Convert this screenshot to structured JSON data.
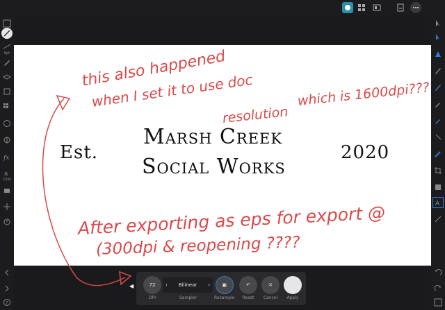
{
  "toolbar": {
    "buttons": [
      "persona-icon",
      "grid-icon",
      "export-icon",
      "document-icon",
      "more-icon"
    ]
  },
  "left_tools": {
    "brush_size_label": "8pt",
    "opacity_label": "12pt"
  },
  "document": {
    "logo": {
      "est": "Est.",
      "line1": "Marsh Creek",
      "line2": "Social Works",
      "year": "2020"
    },
    "annotations": [
      "this also happened",
      "when I set it to use doc",
      "resolution",
      "which is 1600dpi???",
      "After exporting as eps for export @",
      "(300dpi & reopening ????"
    ],
    "annotation_color": "#d94a4a"
  },
  "resample_panel": {
    "dpi_value": "72",
    "dpi_label": "DPI",
    "sampler_value": "Bilinear",
    "sampler_label": "Sampler",
    "resample_label": "Resample",
    "reset_label": "Reset",
    "cancel_label": "Cancel",
    "apply_label": "Apply"
  },
  "colors": {
    "accent": "#2f7bd6",
    "background": "#1c1c1e"
  }
}
